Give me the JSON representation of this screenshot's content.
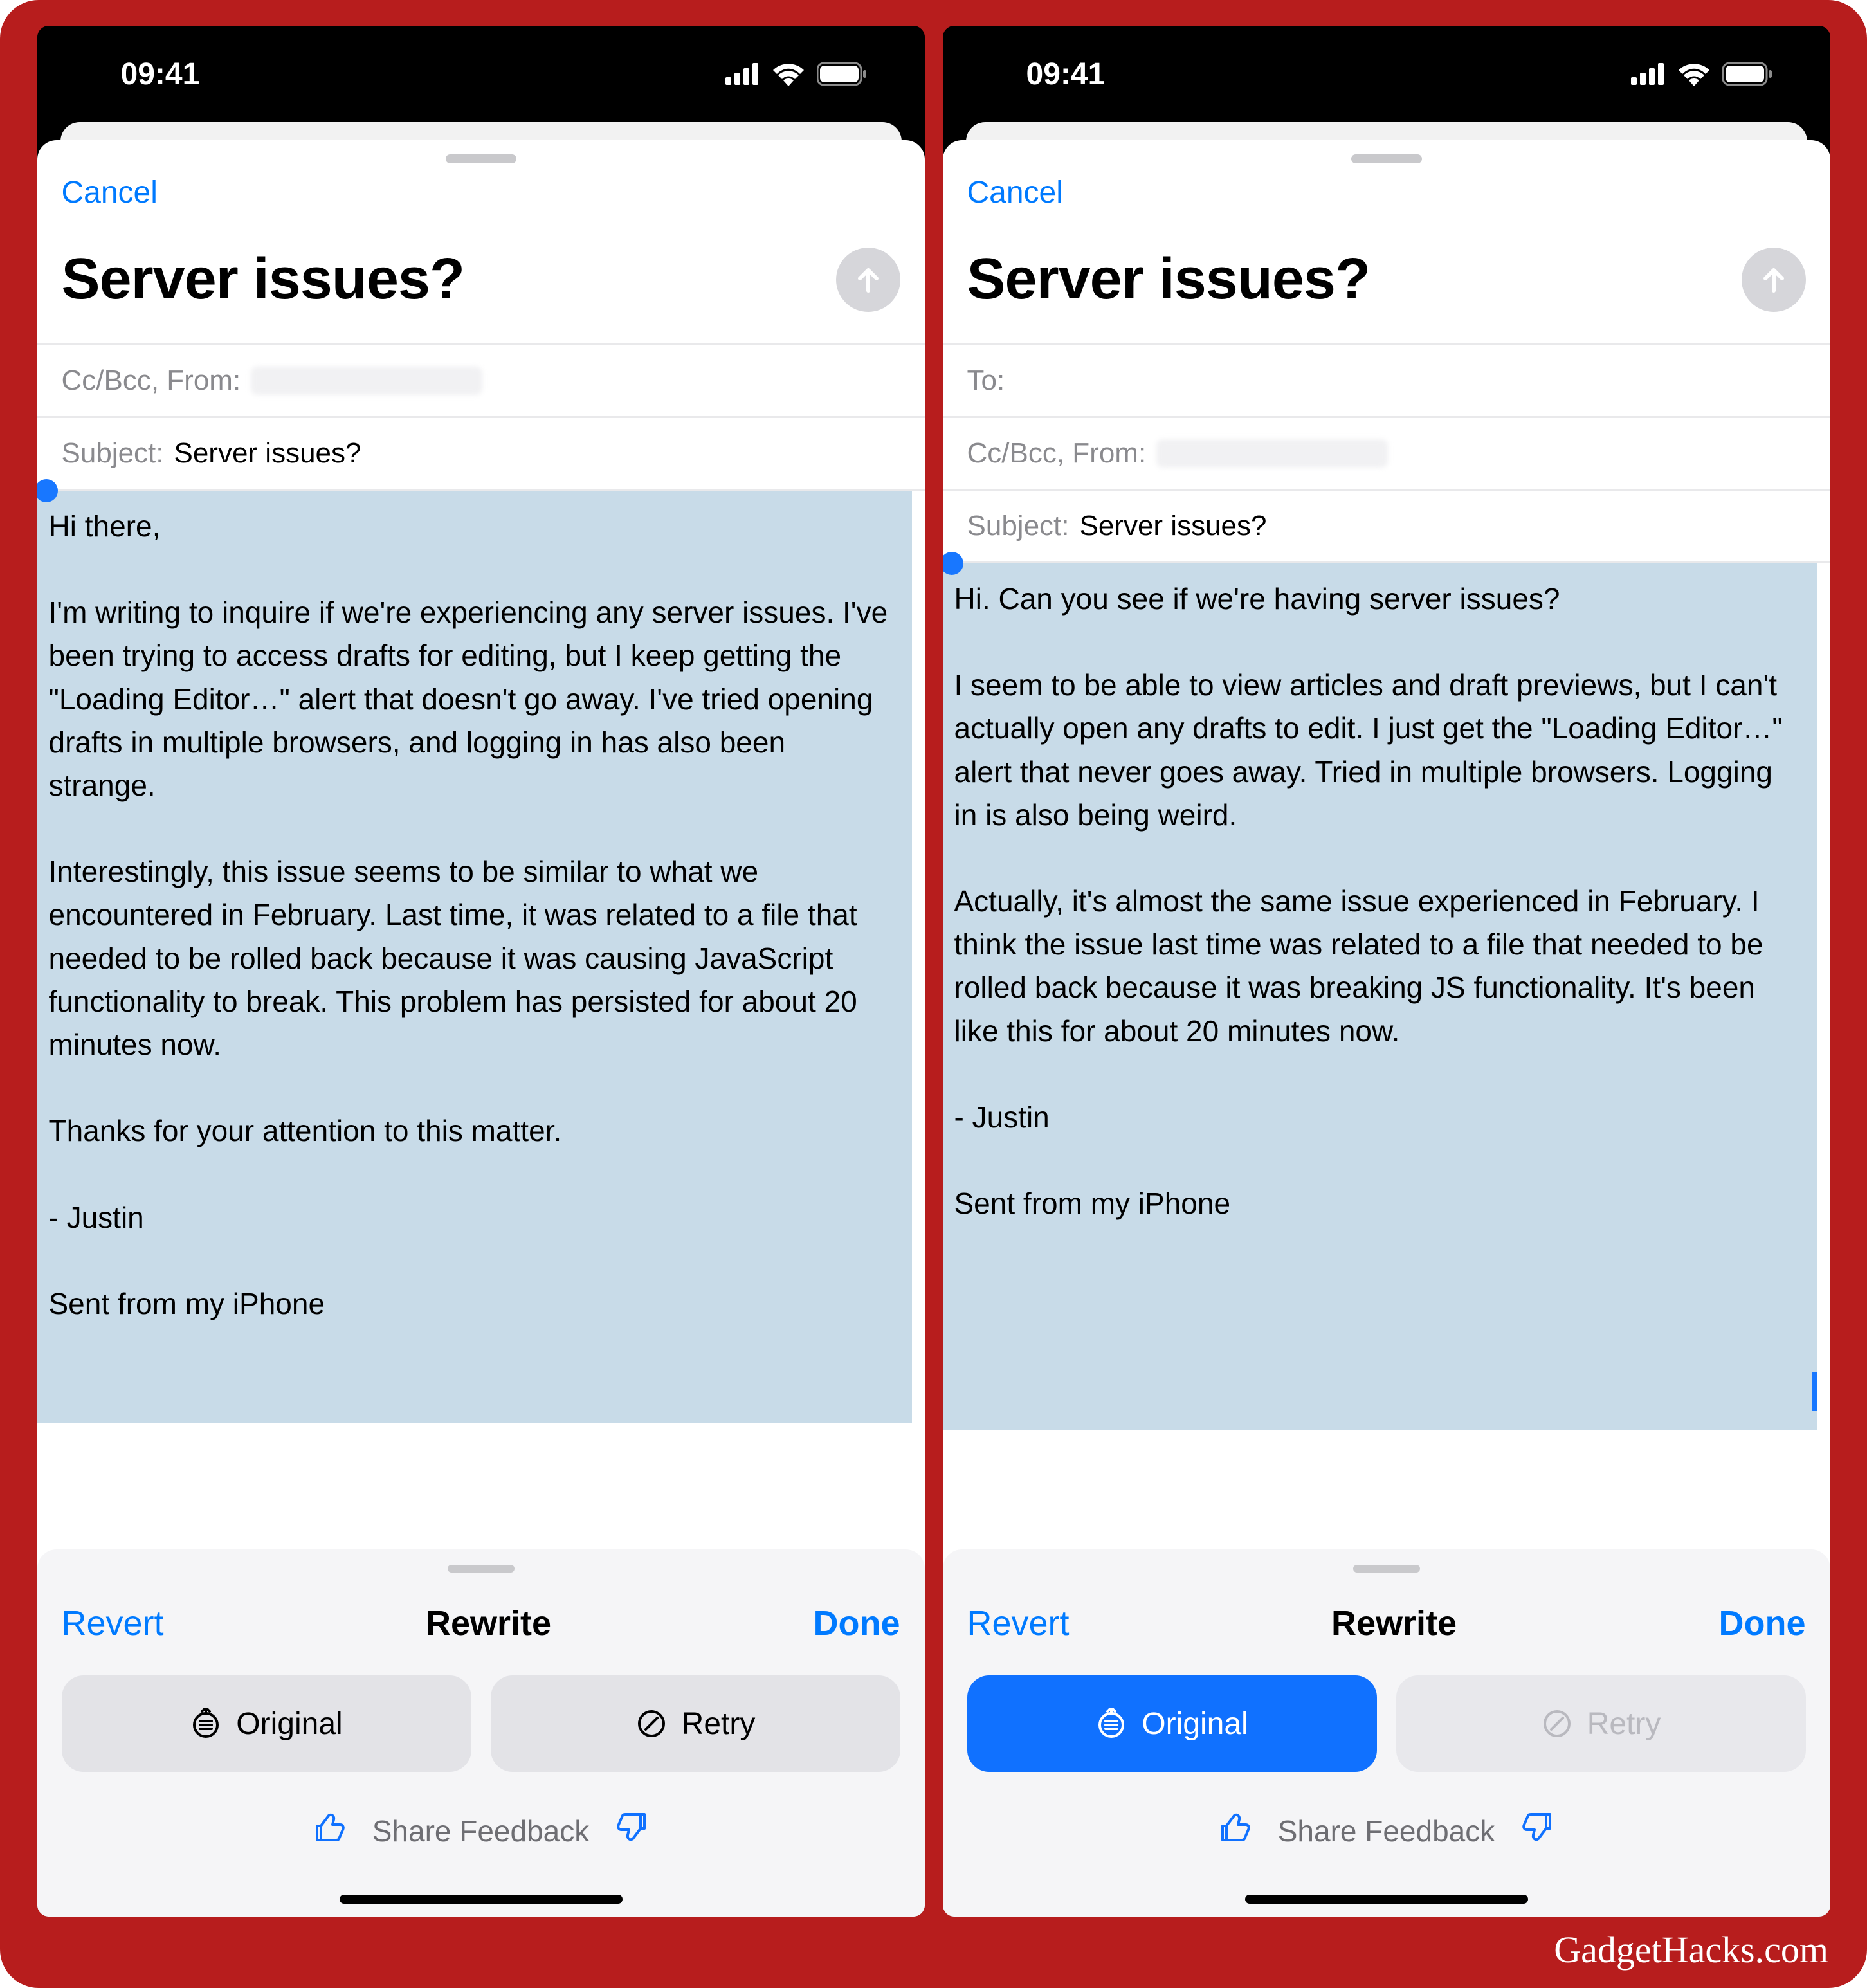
{
  "status": {
    "time": "09:41"
  },
  "compose": {
    "cancel": "Cancel",
    "title": "Server issues?",
    "to_label": "To:",
    "ccbcc_label": "Cc/Bcc, From:",
    "subject_label": "Subject:",
    "subject_value": "Server issues?"
  },
  "body_left": "Hi there,\n\nI'm writing to inquire if we're experiencing any server issues. I've been trying to access drafts for editing, but I keep getting the \"Loading Editor…\" alert that doesn't go away. I've tried opening drafts in multiple browsers, and logging in has also been strange.\n\nInterestingly, this issue seems to be similar to what we encountered in February. Last time, it was related to a file that needed to be rolled back because it was causing JavaScript functionality to break. This problem has persisted for about 20 minutes now.\n\nThanks for your attention to this matter.\n\n- Justin\n\nSent from my iPhone",
  "body_right": "Hi. Can you see if we're having server issues?\n\nI seem to be able to view articles and draft previews, but I can't actually open any drafts to edit. I just get the \"Loading Editor…\" alert that never goes away. Tried in multiple browsers. Logging in is also being weird.\n\nActually, it's almost the same issue experienced in February. I think the issue last time was related to a file that needed to be rolled back because it was breaking JS functionality. It's been like this for about 20 minutes now.\n\n- Justin\n\nSent from my iPhone",
  "toolbar": {
    "revert": "Revert",
    "rewrite": "Rewrite",
    "done": "Done",
    "original": "Original",
    "retry": "Retry",
    "feedback": "Share Feedback"
  },
  "watermark": "GadgetHacks.com"
}
